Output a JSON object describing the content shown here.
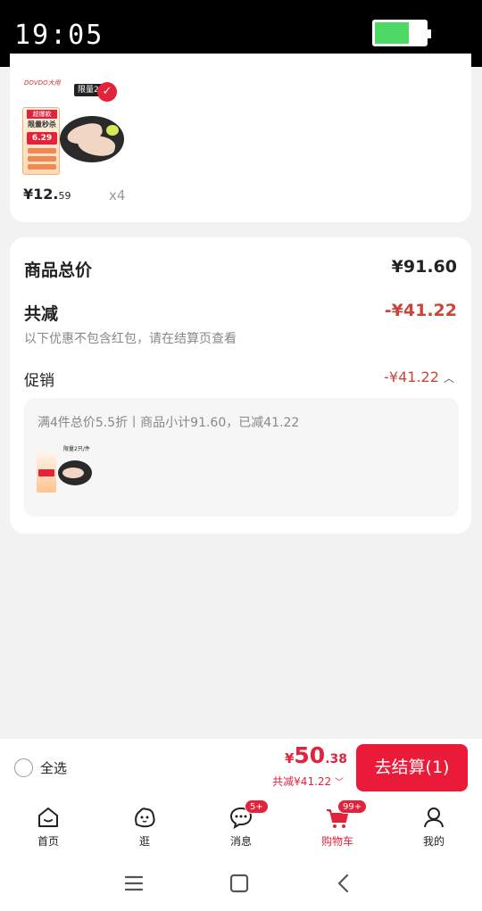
{
  "status": {
    "time": "19:05"
  },
  "product": {
    "brand": "DOVDO大用",
    "limit_badge": "限量2",
    "poster_tag": "超爆款",
    "poster_title": "限量秒杀",
    "poster_price": "6.29",
    "price_int": "¥12.",
    "price_dec": "59",
    "quantity": "x4"
  },
  "summary": {
    "total_label": "商品总价",
    "total_value": "¥91.60",
    "discount_label": "共减",
    "discount_value": "-¥41.22",
    "note": "以下优惠不包含红包，请在结算页查看",
    "promo_label": "促销",
    "promo_value": "-¥41.22",
    "promo_desc": "满4件总价5.5折丨商品小计91.60，已减41.22",
    "thumb_badge": "限量2只/件"
  },
  "checkout": {
    "select_all": "全选",
    "price_symbol": "¥",
    "price_int": "50",
    "price_dec": ".38",
    "saved": "共减¥41.22",
    "button": "去结算(1)"
  },
  "tabs": [
    {
      "label": "首页",
      "icon": "home-icon"
    },
    {
      "label": "逛",
      "icon": "browse-icon"
    },
    {
      "label": "消息",
      "icon": "message-icon",
      "badge": "5+"
    },
    {
      "label": "购物车",
      "icon": "cart-icon",
      "badge": "99+",
      "active": true
    },
    {
      "label": "我的",
      "icon": "profile-icon"
    }
  ],
  "colors": {
    "accent": "#e3233c",
    "discount": "#c8473a",
    "background": "#f2f2f2"
  }
}
